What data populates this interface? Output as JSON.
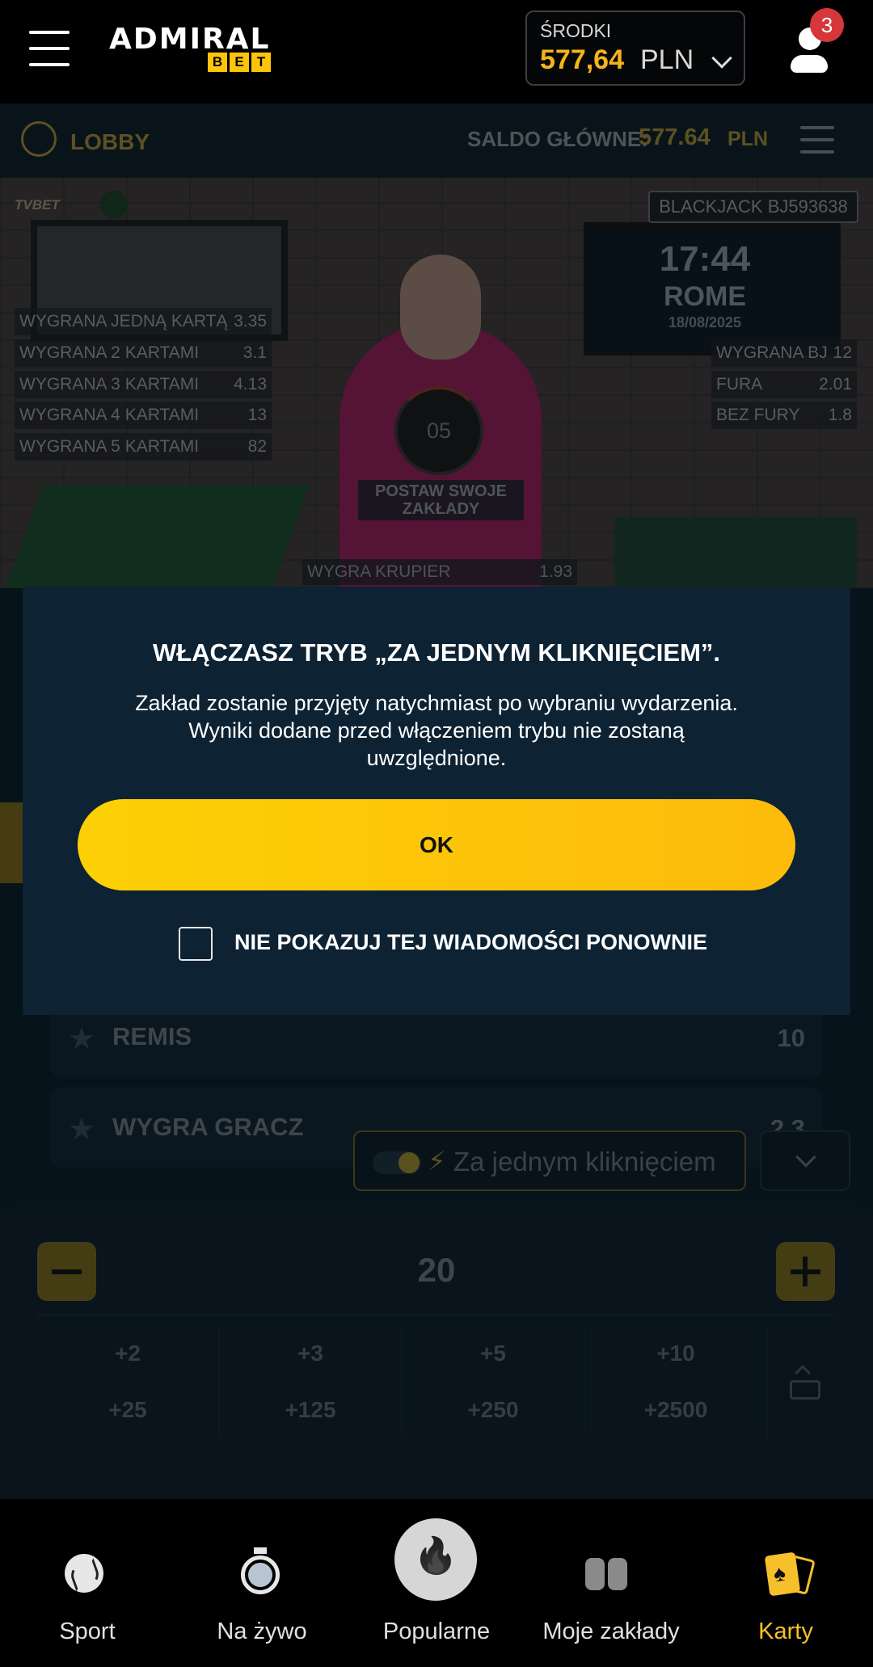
{
  "header": {
    "funds_label": "ŚRODKI",
    "funds_amount": "577,64",
    "funds_currency": "PLN",
    "notifications_count": "3",
    "logo_name": "ADMIRAL",
    "logo_bet": [
      "B",
      "E",
      "T"
    ]
  },
  "game_bar": {
    "lobby_label": "LOBBY",
    "balance_label": "SALDO GŁÓWNE:",
    "balance_value": "577.64",
    "balance_currency": "PLN"
  },
  "stream": {
    "provider": "TVBET",
    "table_id": "BLACKJACK BJ593638",
    "time": "17:44",
    "city": "ROME",
    "date": "18/08/2025",
    "countdown": "05",
    "place_bets": "POSTAW SWOJE ZAKŁADY",
    "left_odds": [
      {
        "name": "WYGRANA JEDNĄ KARTĄ",
        "value": "3.35"
      },
      {
        "name": "WYGRANA 2 KARTAMI",
        "value": "3.1"
      },
      {
        "name": "WYGRANA 3 KARTAMI",
        "value": "4.13"
      },
      {
        "name": "WYGRANA 4 KARTAMI",
        "value": "13"
      },
      {
        "name": "WYGRANA 5 KARTAMI",
        "value": "82"
      }
    ],
    "right_odds": [
      {
        "name": "WYGRANA BJ",
        "value": "12"
      },
      {
        "name": "FURA",
        "value": "2.01"
      },
      {
        "name": "BEZ FURY",
        "value": "1.8"
      }
    ],
    "dealer_win": {
      "name": "WYGRA KRUPIER",
      "value": "1.93"
    }
  },
  "bets": [
    {
      "name": "REMIS",
      "value": "10"
    },
    {
      "name": "WYGRA GRACZ",
      "value": "2.3"
    }
  ],
  "one_click": {
    "label": "Za jednym kliknięciem",
    "bolt": "⚡"
  },
  "stake": {
    "value": "20",
    "chips": [
      "+2",
      "+3",
      "+5",
      "+10",
      "+25",
      "+125",
      "+250",
      "+2500"
    ]
  },
  "modal": {
    "title": "WŁĄCZASZ TRYB „ZA JEDNYM KLIKNIĘCIEM”.",
    "text": "Zakład zostanie przyjęty natychmiast po wybraniu wydarzenia. Wyniki dodane przed włączeniem trybu nie zostaną uwzględnione.",
    "ok_label": "OK",
    "checkbox_label": "NIE POKAZUJ TEJ WIADOMOŚCI PONOWNIE"
  },
  "bottom_nav": [
    {
      "label": "Sport",
      "icon": "sport-ball-icon"
    },
    {
      "label": "Na żywo",
      "icon": "stopwatch-icon"
    },
    {
      "label": "Popularne",
      "icon": "fire-icon"
    },
    {
      "label": "Moje zakłady",
      "icon": "tickets-icon"
    },
    {
      "label": "Karty",
      "icon": "cards-icon",
      "active": true
    }
  ],
  "colors": {
    "accent": "#fdc40a",
    "modal_bg": "#0d2233",
    "active_nav": "#f6c02c",
    "badge": "#d5373b"
  }
}
